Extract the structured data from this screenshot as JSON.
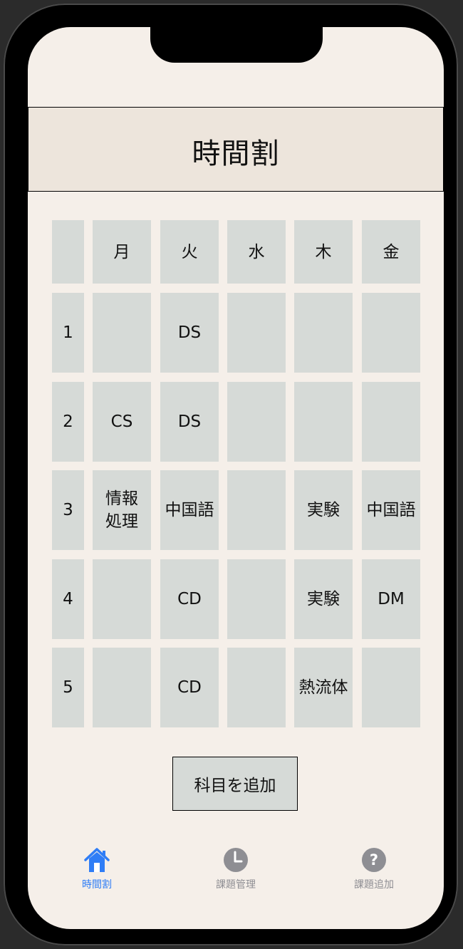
{
  "header": {
    "title": "時間割"
  },
  "timetable": {
    "days": [
      "月",
      "火",
      "水",
      "木",
      "金"
    ],
    "rows": [
      {
        "period": "1",
        "cells": [
          "",
          "DS",
          "",
          "",
          ""
        ]
      },
      {
        "period": "2",
        "cells": [
          "CS",
          "DS",
          "",
          "",
          ""
        ]
      },
      {
        "period": "3",
        "cells": [
          "情報\n処理",
          "中国語",
          "",
          "実験",
          "中国語"
        ]
      },
      {
        "period": "4",
        "cells": [
          "",
          "CD",
          "",
          "実験",
          "DM"
        ]
      },
      {
        "period": "5",
        "cells": [
          "",
          "CD",
          "",
          "熱流体",
          ""
        ]
      }
    ]
  },
  "add_button": {
    "label": "科目を追加"
  },
  "tabbar": {
    "items": [
      {
        "label": "時間割",
        "icon": "house-icon",
        "active": true
      },
      {
        "label": "課題管理",
        "icon": "clock-icon",
        "active": false
      },
      {
        "label": "課題追加",
        "icon": "question-icon",
        "active": false
      }
    ]
  },
  "colors": {
    "background": "#f5efe9",
    "header": "#ede5dc",
    "cell": "#d6dad7",
    "active_tab": "#2f7df6",
    "inactive_tab": "#8e8e93"
  }
}
